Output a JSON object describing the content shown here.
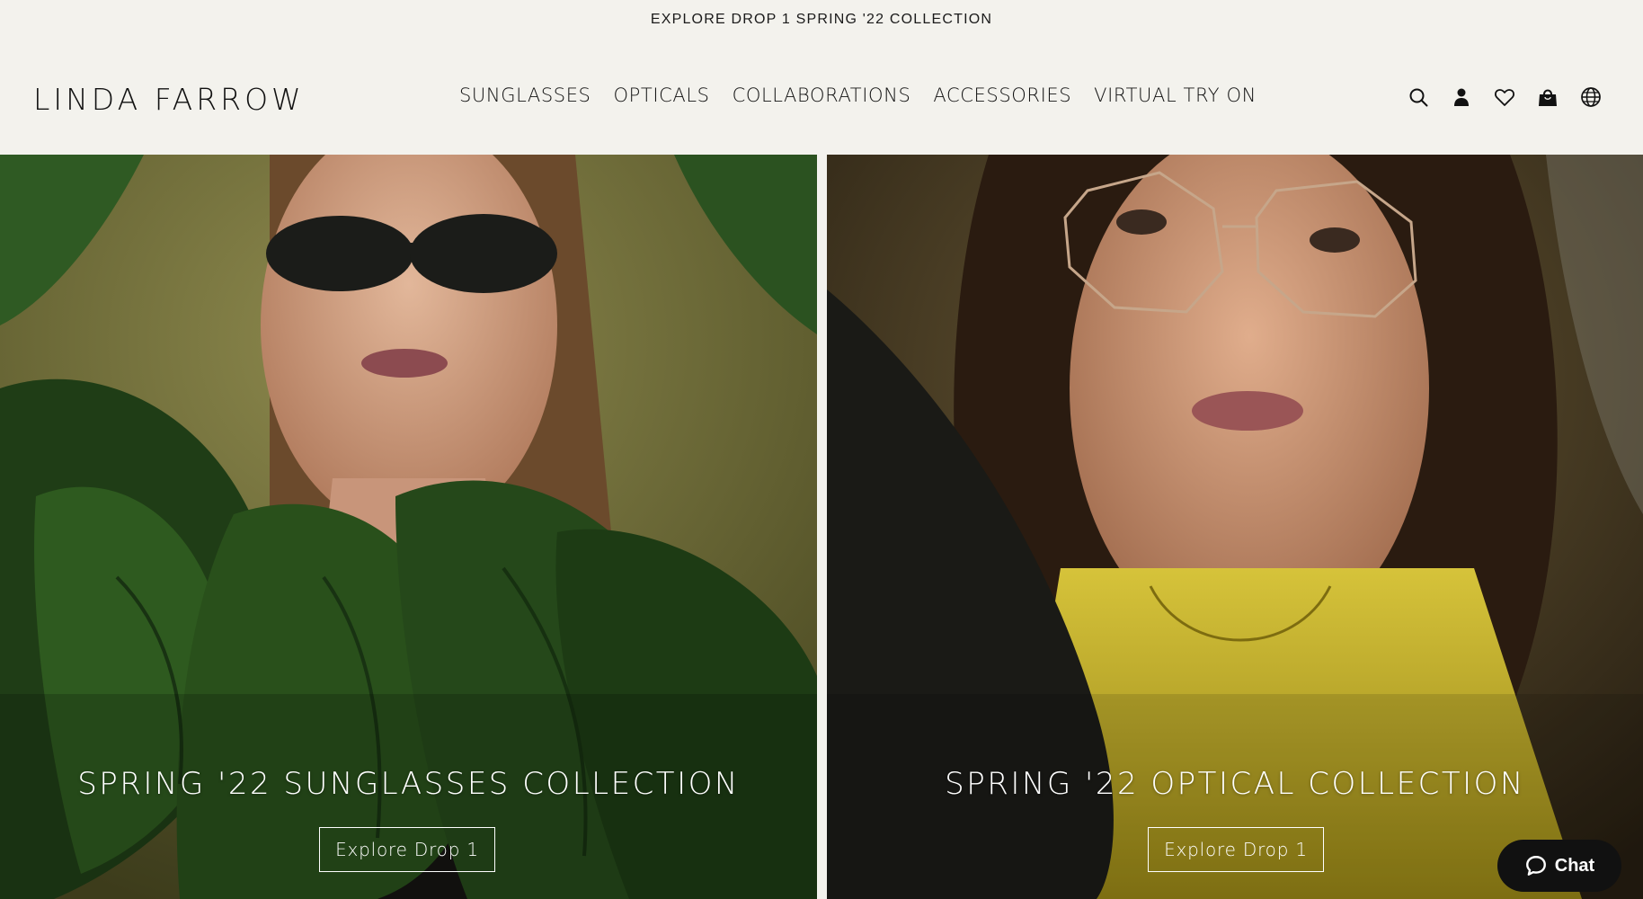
{
  "announcement": {
    "text": "EXPLORE DROP 1 SPRING '22 COLLECTION"
  },
  "header": {
    "logo": "LINDA FARROW",
    "nav": [
      {
        "label": "SUNGLASSES"
      },
      {
        "label": "OPTICALS"
      },
      {
        "label": "COLLABORATIONS"
      },
      {
        "label": "ACCESSORIES"
      },
      {
        "label": "VIRTUAL TRY ON"
      }
    ],
    "icons": [
      "search-icon",
      "account-icon",
      "wishlist-icon",
      "bag-icon",
      "globe-icon"
    ]
  },
  "heroes": [
    {
      "title": "SPRING '22 SUNGLASSES COLLECTION",
      "button": "Explore Drop 1"
    },
    {
      "title": "SPRING '22 OPTICAL COLLECTION",
      "button": "Explore Drop 1"
    }
  ],
  "chat": {
    "label": "Chat"
  },
  "colors": {
    "background": "#f3f2ed",
    "text": "#111111",
    "chat_button": "#111111",
    "hero_text": "#ffffff"
  }
}
